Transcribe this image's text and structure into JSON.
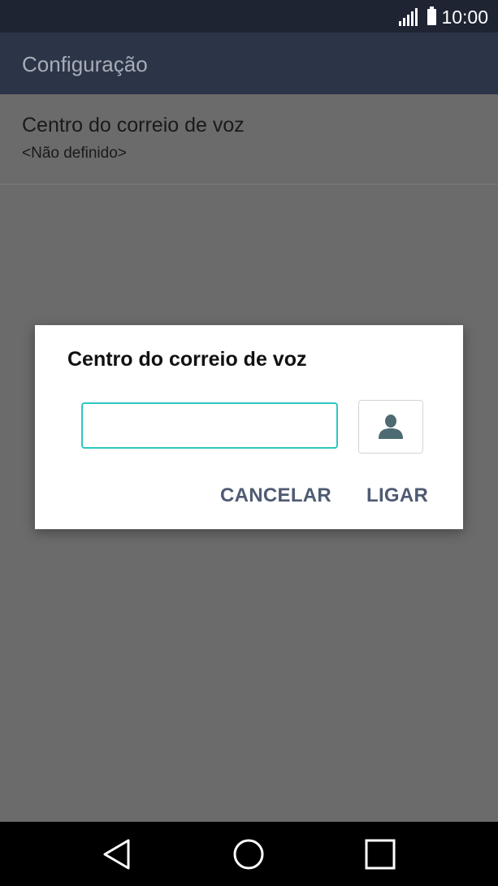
{
  "status_bar": {
    "time": "10:00",
    "icons": [
      "signal-icon",
      "battery-icon"
    ]
  },
  "app_bar": {
    "title": "Configuração"
  },
  "preference": {
    "title": "Centro do correio de voz",
    "summary": "<Não definido>"
  },
  "dialog": {
    "title": "Centro do correio de voz",
    "input_value": "",
    "contact_icon": "contact-person-icon",
    "cancel_label": "CANCELAR",
    "call_label": "LIGAR",
    "accent_color": "#2ec7c0"
  },
  "nav_bar": {
    "icons": [
      "back-icon",
      "home-icon",
      "recents-icon"
    ]
  }
}
